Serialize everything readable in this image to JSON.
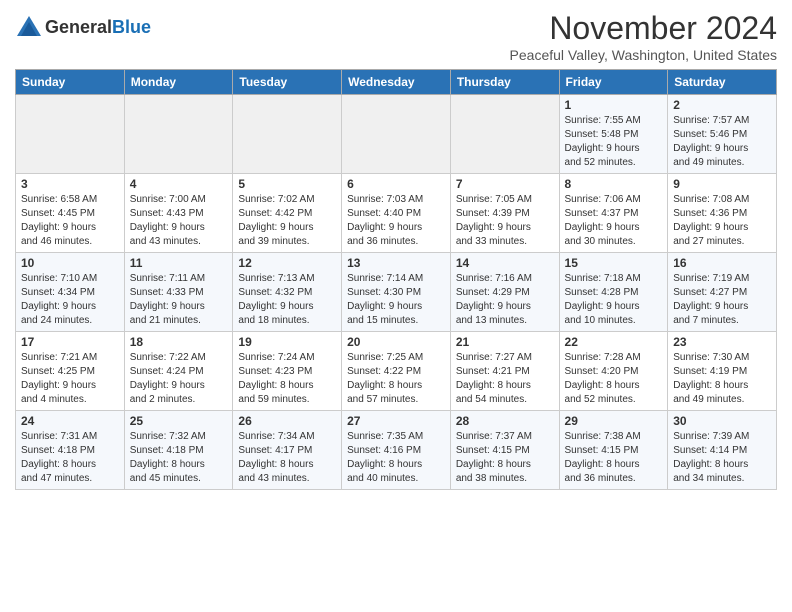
{
  "logo": {
    "general": "General",
    "blue": "Blue"
  },
  "title": "November 2024",
  "subtitle": "Peaceful Valley, Washington, United States",
  "days_header": [
    "Sunday",
    "Monday",
    "Tuesday",
    "Wednesday",
    "Thursday",
    "Friday",
    "Saturday"
  ],
  "weeks": [
    [
      {
        "day": "",
        "info": ""
      },
      {
        "day": "",
        "info": ""
      },
      {
        "day": "",
        "info": ""
      },
      {
        "day": "",
        "info": ""
      },
      {
        "day": "",
        "info": ""
      },
      {
        "day": "1",
        "info": "Sunrise: 7:55 AM\nSunset: 5:48 PM\nDaylight: 9 hours\nand 52 minutes."
      },
      {
        "day": "2",
        "info": "Sunrise: 7:57 AM\nSunset: 5:46 PM\nDaylight: 9 hours\nand 49 minutes."
      }
    ],
    [
      {
        "day": "3",
        "info": "Sunrise: 6:58 AM\nSunset: 4:45 PM\nDaylight: 9 hours\nand 46 minutes."
      },
      {
        "day": "4",
        "info": "Sunrise: 7:00 AM\nSunset: 4:43 PM\nDaylight: 9 hours\nand 43 minutes."
      },
      {
        "day": "5",
        "info": "Sunrise: 7:02 AM\nSunset: 4:42 PM\nDaylight: 9 hours\nand 39 minutes."
      },
      {
        "day": "6",
        "info": "Sunrise: 7:03 AM\nSunset: 4:40 PM\nDaylight: 9 hours\nand 36 minutes."
      },
      {
        "day": "7",
        "info": "Sunrise: 7:05 AM\nSunset: 4:39 PM\nDaylight: 9 hours\nand 33 minutes."
      },
      {
        "day": "8",
        "info": "Sunrise: 7:06 AM\nSunset: 4:37 PM\nDaylight: 9 hours\nand 30 minutes."
      },
      {
        "day": "9",
        "info": "Sunrise: 7:08 AM\nSunset: 4:36 PM\nDaylight: 9 hours\nand 27 minutes."
      }
    ],
    [
      {
        "day": "10",
        "info": "Sunrise: 7:10 AM\nSunset: 4:34 PM\nDaylight: 9 hours\nand 24 minutes."
      },
      {
        "day": "11",
        "info": "Sunrise: 7:11 AM\nSunset: 4:33 PM\nDaylight: 9 hours\nand 21 minutes."
      },
      {
        "day": "12",
        "info": "Sunrise: 7:13 AM\nSunset: 4:32 PM\nDaylight: 9 hours\nand 18 minutes."
      },
      {
        "day": "13",
        "info": "Sunrise: 7:14 AM\nSunset: 4:30 PM\nDaylight: 9 hours\nand 15 minutes."
      },
      {
        "day": "14",
        "info": "Sunrise: 7:16 AM\nSunset: 4:29 PM\nDaylight: 9 hours\nand 13 minutes."
      },
      {
        "day": "15",
        "info": "Sunrise: 7:18 AM\nSunset: 4:28 PM\nDaylight: 9 hours\nand 10 minutes."
      },
      {
        "day": "16",
        "info": "Sunrise: 7:19 AM\nSunset: 4:27 PM\nDaylight: 9 hours\nand 7 minutes."
      }
    ],
    [
      {
        "day": "17",
        "info": "Sunrise: 7:21 AM\nSunset: 4:25 PM\nDaylight: 9 hours\nand 4 minutes."
      },
      {
        "day": "18",
        "info": "Sunrise: 7:22 AM\nSunset: 4:24 PM\nDaylight: 9 hours\nand 2 minutes."
      },
      {
        "day": "19",
        "info": "Sunrise: 7:24 AM\nSunset: 4:23 PM\nDaylight: 8 hours\nand 59 minutes."
      },
      {
        "day": "20",
        "info": "Sunrise: 7:25 AM\nSunset: 4:22 PM\nDaylight: 8 hours\nand 57 minutes."
      },
      {
        "day": "21",
        "info": "Sunrise: 7:27 AM\nSunset: 4:21 PM\nDaylight: 8 hours\nand 54 minutes."
      },
      {
        "day": "22",
        "info": "Sunrise: 7:28 AM\nSunset: 4:20 PM\nDaylight: 8 hours\nand 52 minutes."
      },
      {
        "day": "23",
        "info": "Sunrise: 7:30 AM\nSunset: 4:19 PM\nDaylight: 8 hours\nand 49 minutes."
      }
    ],
    [
      {
        "day": "24",
        "info": "Sunrise: 7:31 AM\nSunset: 4:18 PM\nDaylight: 8 hours\nand 47 minutes."
      },
      {
        "day": "25",
        "info": "Sunrise: 7:32 AM\nSunset: 4:18 PM\nDaylight: 8 hours\nand 45 minutes."
      },
      {
        "day": "26",
        "info": "Sunrise: 7:34 AM\nSunset: 4:17 PM\nDaylight: 8 hours\nand 43 minutes."
      },
      {
        "day": "27",
        "info": "Sunrise: 7:35 AM\nSunset: 4:16 PM\nDaylight: 8 hours\nand 40 minutes."
      },
      {
        "day": "28",
        "info": "Sunrise: 7:37 AM\nSunset: 4:15 PM\nDaylight: 8 hours\nand 38 minutes."
      },
      {
        "day": "29",
        "info": "Sunrise: 7:38 AM\nSunset: 4:15 PM\nDaylight: 8 hours\nand 36 minutes."
      },
      {
        "day": "30",
        "info": "Sunrise: 7:39 AM\nSunset: 4:14 PM\nDaylight: 8 hours\nand 34 minutes."
      }
    ]
  ]
}
